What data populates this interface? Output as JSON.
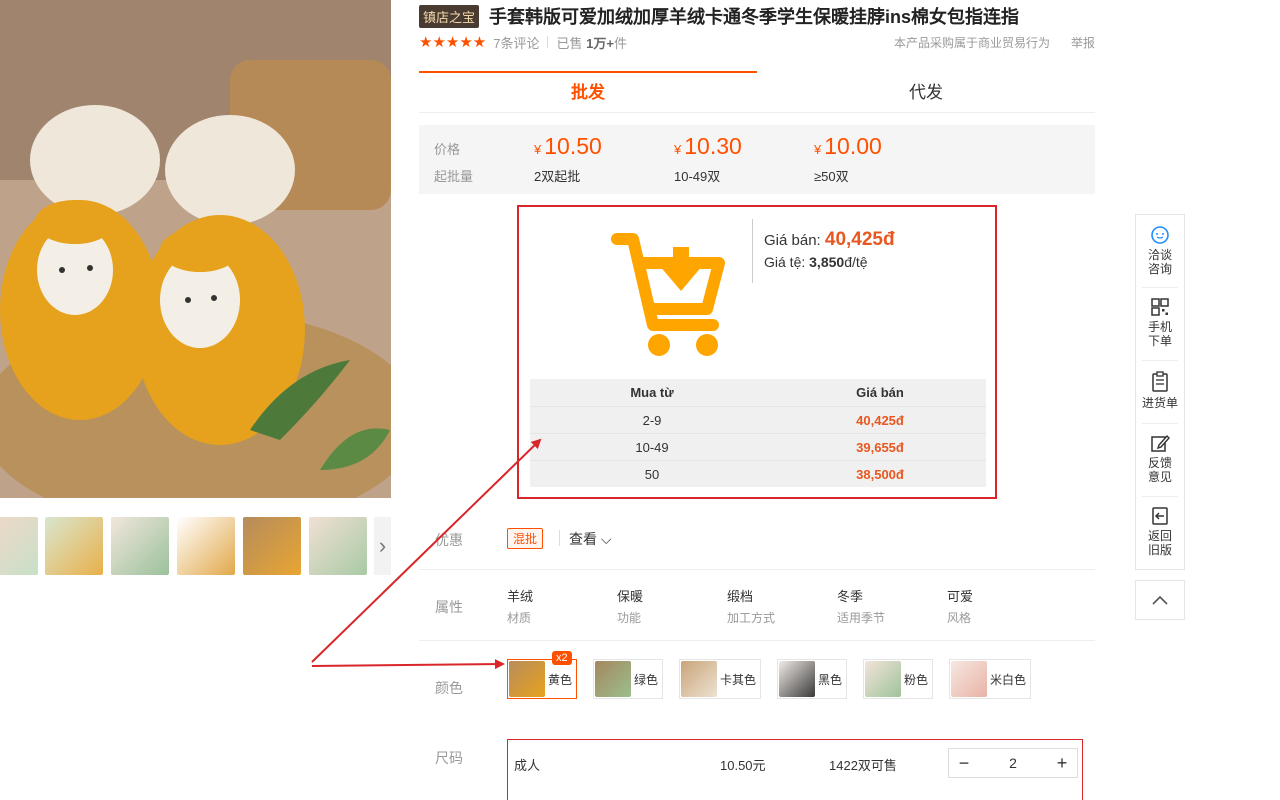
{
  "product": {
    "shop_tag": "镇店之宝",
    "title": "手套韩版可爱加绒加厚羊绒卡通冬季学生保暖挂脖ins棉女包指连指",
    "stars": "★★★★★",
    "reviews": "7条评论",
    "sold_prefix": "已售",
    "sold_value": "1万+",
    "sold_suffix": "件",
    "trade_note": "本产品采购属于商业贸易行为",
    "report": "举报"
  },
  "tabs": [
    {
      "label": "批发"
    },
    {
      "label": "代发"
    }
  ],
  "pricing": {
    "price_label": "价格",
    "moq_label": "起批量",
    "currency": "¥",
    "tiers": [
      {
        "price": "10.50",
        "qty": "2双起批"
      },
      {
        "price": "10.30",
        "qty": "10-49双"
      },
      {
        "price": "10.00",
        "qty": "≥50双"
      }
    ]
  },
  "extension": {
    "sale_label": "Giá bán: ",
    "sale_value": "40,425đ",
    "unit_label": "Giá tệ: ",
    "unit_value": "3,850",
    "unit_suffix": "đ/tệ",
    "table_head": [
      "Mua từ",
      "Giá bán"
    ],
    "rows": [
      {
        "from": "2-9",
        "price": "40,425đ"
      },
      {
        "from": "10-49",
        "price": "39,655đ"
      },
      {
        "from": "50",
        "price": "38,500đ"
      }
    ],
    "cart_color": "#ffa500",
    "border_color": "#d9262a"
  },
  "promo": {
    "label": "优惠",
    "badge": "混批",
    "view": "查看 ⌵"
  },
  "attributes": {
    "label": "属性",
    "items": [
      {
        "value": "羊绒",
        "key": "材质"
      },
      {
        "value": "保暖",
        "key": "功能"
      },
      {
        "value": "缎档",
        "key": "加工方式"
      },
      {
        "value": "冬季",
        "key": "适用季节"
      },
      {
        "value": "可爱",
        "key": "风格"
      }
    ]
  },
  "colors": {
    "label": "颜色",
    "selected_count": "x2",
    "items": [
      {
        "label": "黄色"
      },
      {
        "label": "绿色"
      },
      {
        "label": "卡其色"
      },
      {
        "label": "黑色"
      },
      {
        "label": "粉色"
      },
      {
        "label": "米白色"
      }
    ]
  },
  "size": {
    "label": "尺码",
    "name": "成人",
    "price": "10.50元",
    "stock": "1422双可售",
    "qty": "2",
    "minus": "−",
    "plus": "+"
  },
  "sidebar": {
    "items": [
      {
        "label": "洽谈\n咨询",
        "icon": "chat-icon"
      },
      {
        "label": "手机\n下单",
        "icon": "qr-icon"
      },
      {
        "label": "进货单",
        "icon": "clipboard-icon"
      },
      {
        "label": "反馈\n意见",
        "icon": "edit-icon"
      },
      {
        "label": "返回\n旧版",
        "icon": "back-icon"
      }
    ],
    "top_icon": "chevron-up-icon"
  },
  "thumb_next": "›",
  "accent": "#ff5000"
}
